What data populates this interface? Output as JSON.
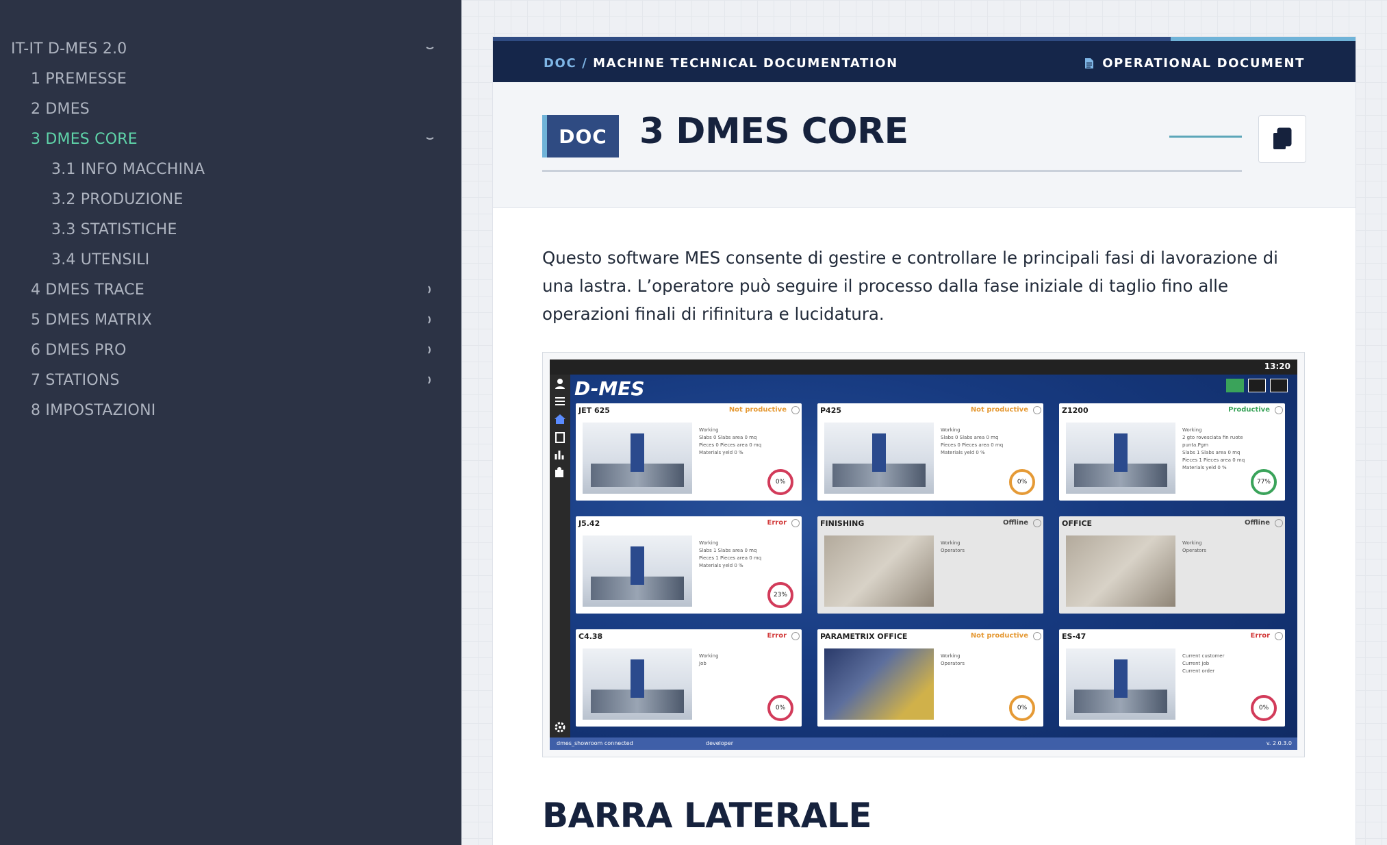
{
  "sidebar": {
    "items": [
      {
        "label": "IT-IT D-MES 2.0",
        "level": 0,
        "chevron": "down",
        "active": false
      },
      {
        "label": "1 PREMESSE",
        "level": 1,
        "chevron": "",
        "active": false
      },
      {
        "label": "2 DMES",
        "level": 1,
        "chevron": "",
        "active": false
      },
      {
        "label": "3 DMES CORE",
        "level": 1,
        "chevron": "down",
        "active": true
      },
      {
        "label": "3.1 INFO MACCHINA",
        "level": 2,
        "chevron": "",
        "active": false
      },
      {
        "label": "3.2 PRODUZIONE",
        "level": 2,
        "chevron": "",
        "active": false
      },
      {
        "label": "3.3 STATISTICHE",
        "level": 2,
        "chevron": "",
        "active": false
      },
      {
        "label": "3.4 UTENSILI",
        "level": 2,
        "chevron": "",
        "active": false
      },
      {
        "label": "4 DMES TRACE",
        "level": 1,
        "chevron": "right",
        "active": false
      },
      {
        "label": "5 DMES MATRIX",
        "level": 1,
        "chevron": "right",
        "active": false
      },
      {
        "label": "6 DMES PRO",
        "level": 1,
        "chevron": "right",
        "active": false
      },
      {
        "label": "7 STATIONS",
        "level": 1,
        "chevron": "right",
        "active": false
      },
      {
        "label": "8 IMPOSTAZIONI",
        "level": 1,
        "chevron": "",
        "active": false
      }
    ]
  },
  "topbar": {
    "crumb_doc": "DOC /",
    "crumb_title": "MACHINE TECHNICAL DOCUMENTATION",
    "doc_type": "OPERATIONAL DOCUMENT",
    "doc_type_icon": "document-icon"
  },
  "header": {
    "badge": "DOC",
    "title": "3 DMES CORE",
    "copy_icon": "copy-icon"
  },
  "body": {
    "paragraph": "Questo software MES consente di gestire e controllare le principali fasi di lavorazione di una lastra. L’operatore può seguire il processo dalla fase iniziale di taglio fino alle operazioni finali di rifinitura e lucidatura.",
    "section_title": "BARRA LATERALE"
  },
  "screenshot": {
    "logo": "D-MES",
    "time": "13:20",
    "status_left": "dmes_showroom connected",
    "status_user": "developer",
    "version": "v. 2.0.3.0",
    "tiles": [
      {
        "name": "JET 625",
        "status": "Not productive",
        "kind": "np",
        "gauge": "0%",
        "gauge_kind": "r",
        "img": "machine",
        "meta": [
          "Working",
          "Slabs 0   Slabs area 0 mq",
          "Pieces 0   Pieces area 0 mq",
          "Materials yeld 0 %"
        ]
      },
      {
        "name": "P425",
        "status": "Not productive",
        "kind": "np",
        "gauge": "0%",
        "gauge_kind": "o",
        "img": "machine",
        "meta": [
          "Working",
          "Slabs 0   Slabs area 0 mq",
          "Pieces 0   Pieces area 0 mq",
          "Materials yeld 0 %"
        ]
      },
      {
        "name": "Z1200",
        "status": "Productive",
        "kind": "pr",
        "gauge": "77%",
        "gauge_kind": "g",
        "img": "machine",
        "meta": [
          "Working",
          "2 gto rovesciata fin ruote punta.Pgm",
          "Slabs 1   Slabs area 0 mq",
          "Pieces 1   Pieces area 0 mq",
          "Materials yeld 0 %"
        ]
      },
      {
        "name": "J5.42",
        "status": "Error",
        "kind": "er",
        "gauge": "23%",
        "gauge_kind": "r",
        "img": "machine",
        "meta": [
          "Working",
          "Slabs 1   Slabs area 0 mq",
          "Pieces 1   Pieces area 0 mq",
          "Materials yeld 0 %"
        ]
      },
      {
        "name": "FINISHING",
        "status": "Offline",
        "kind": "of",
        "gauge": "",
        "gauge_kind": "",
        "img": "photo",
        "meta": [
          "Working",
          "Operators"
        ]
      },
      {
        "name": "OFFICE",
        "status": "Offline",
        "kind": "of",
        "gauge": "",
        "gauge_kind": "",
        "img": "photo",
        "meta": [
          "Working",
          "Operators"
        ]
      },
      {
        "name": "C4.38",
        "status": "Error",
        "kind": "er",
        "gauge": "0%",
        "gauge_kind": "r",
        "img": "machine",
        "meta": [
          "Working",
          "Job"
        ]
      },
      {
        "name": "PARAMETRIX OFFICE",
        "status": "Not productive",
        "kind": "np",
        "gauge": "0%",
        "gauge_kind": "o",
        "img": "blue",
        "meta": [
          "Working",
          "Operators"
        ]
      },
      {
        "name": "ES-47",
        "status": "Error",
        "kind": "er",
        "gauge": "0%",
        "gauge_kind": "r",
        "img": "machine",
        "meta": [
          "Current customer",
          "Current job",
          "Current order"
        ]
      }
    ]
  },
  "colors": {
    "sidebar_bg": "#2c3345",
    "active": "#5fd4a9",
    "topbar": "#15264a",
    "accent": "#2f4b82"
  }
}
